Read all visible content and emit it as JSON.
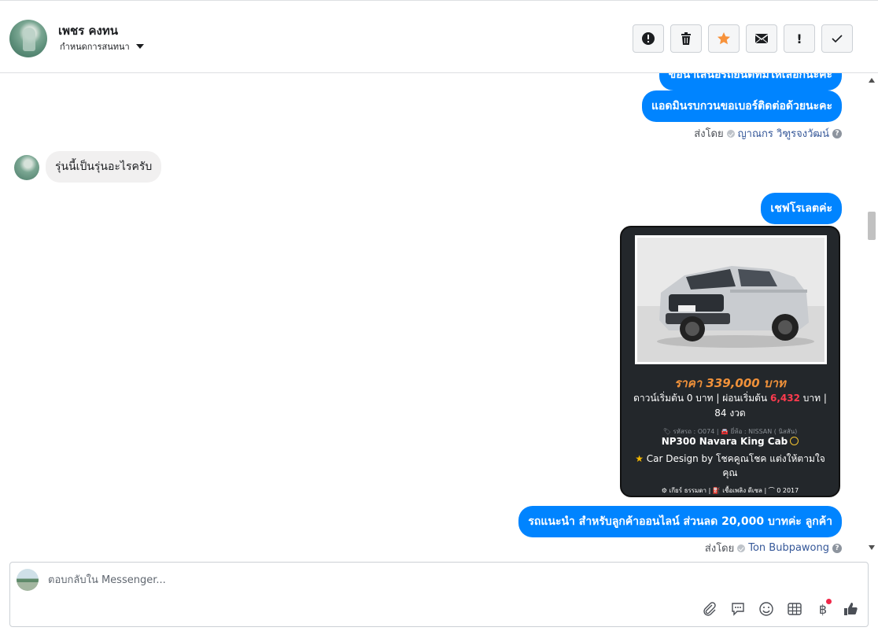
{
  "header": {
    "contact_name": "เพชร คงทน",
    "assign_label": "กำหนดการสนทนา",
    "actions": [
      {
        "name": "mark-spam-button",
        "icon": "alert-circle-icon"
      },
      {
        "name": "delete-button",
        "icon": "trash-icon"
      },
      {
        "name": "star-button",
        "icon": "star-icon"
      },
      {
        "name": "mark-unread-button",
        "icon": "envelope-icon"
      },
      {
        "name": "follow-up-button",
        "icon": "exclamation-icon",
        "text": "!"
      },
      {
        "name": "mark-done-button",
        "icon": "check-icon"
      }
    ],
    "star_color": "#f7923b"
  },
  "messages": {
    "out_partial": "ขอนำเสนอรถยนต์ที่มีให้เลือกนะคะ",
    "out_1": "แอดมินรบกวนขอเบอร์ติดต่อด้วยนะคะ",
    "sent_by_label": "ส่งโดย",
    "sent_by_1": "ญาณกร วิฑูรจงวัฒน์",
    "in_1": "รุ่นนี้เป็นรุ่นอะไรครับ",
    "out_2": "เชฟโรเลตค่ะ",
    "card": {
      "price": "ราคา 339,000 บาท",
      "down_prefix": "ดาวน์เริ่มต้น 0 บาท | ผ่อนเริ่มต้น",
      "installment": "6,432",
      "down_suffix": "บาท | 84 งวด",
      "meta": "🏷 รหัสรถ : O074 | 🚘 ยี่ห้อ : NISSAN ( นิสสัน)",
      "model": "NP300 Navara King Cab",
      "design": "Car Design by โชคคูณโชค แต่งให้ตามใจคุณ",
      "specs": "⚙ เกียร์ ธรรมดา   |  ⛽ เชื้อเพลิง ดีเซล   |  ⌒ 0 2017"
    },
    "out_3": "รถแนะนำ สำหรับลูกค้าออนไลน์ ส่วนลด 20,000 บาทค่ะ ลูกค้า",
    "sent_by_2": "Ton Bubpawong"
  },
  "composer": {
    "placeholder": "ตอบกลับใน Messenger...",
    "tools": [
      "paperclip-icon",
      "saved-reply-icon",
      "emoji-icon",
      "table-icon",
      "baht-icon",
      "thumbs-up-icon"
    ],
    "baht_symbol": "฿"
  },
  "colors": {
    "accent": "#0084ff",
    "price": "#f0913a",
    "installment": "#ff3b4e",
    "card_bg": "#23272b"
  }
}
